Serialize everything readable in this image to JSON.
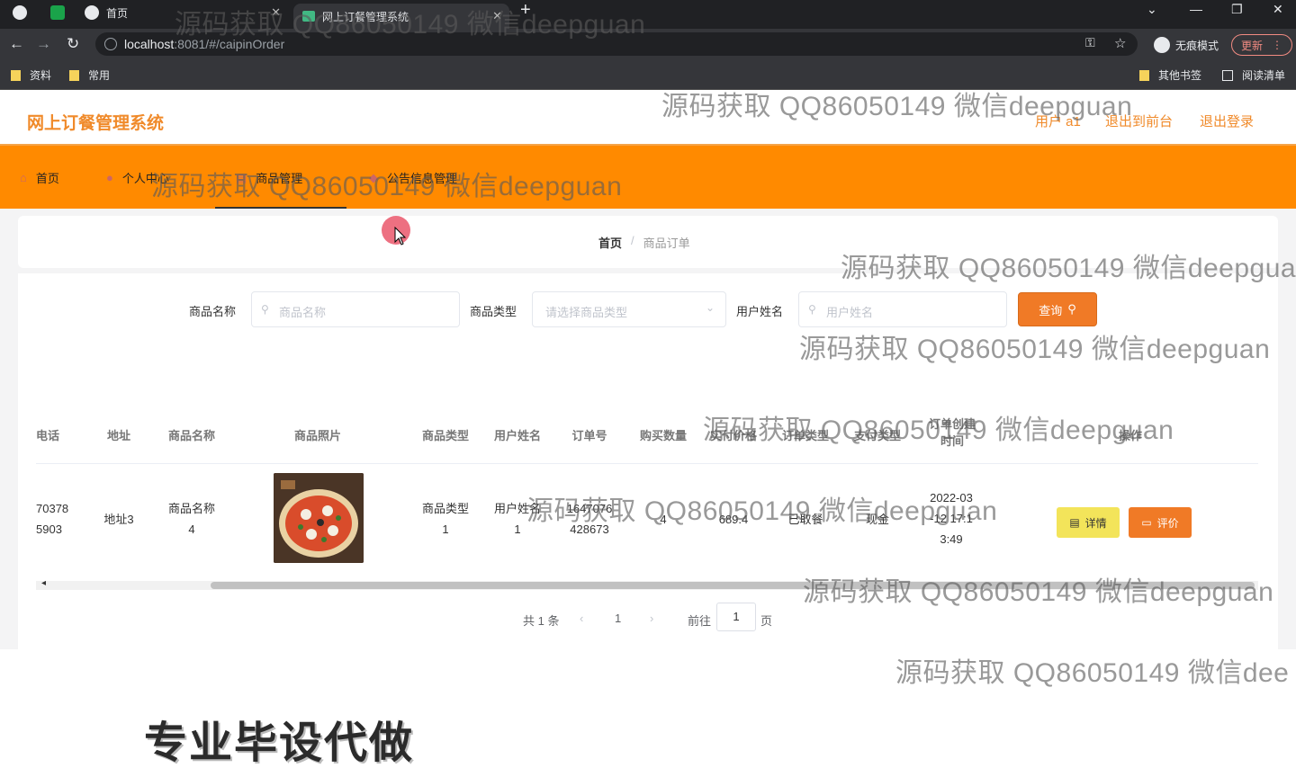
{
  "browser": {
    "tabs": [
      {
        "label": "首页"
      },
      {
        "label": "网上订餐管理系统"
      }
    ],
    "url_host": "localhost",
    "url_rest": ":8081/#/caipinOrder",
    "incognito_label": "无痕模式",
    "update_label": "更新",
    "bookmarks": [
      "资料",
      "常用"
    ],
    "bookmarks_right": [
      "其他书签",
      "阅读清单"
    ]
  },
  "app": {
    "title": "网上订餐管理系统",
    "header_links": [
      "用户 a1",
      "退出到前台",
      "退出登录"
    ],
    "nav": [
      {
        "label": "首页"
      },
      {
        "label": "个人中心"
      },
      {
        "label": "商品管理"
      },
      {
        "label": "公告信息管理"
      }
    ],
    "breadcrumb": {
      "home": "首页",
      "sep": "/",
      "current": "商品订单"
    }
  },
  "filters": {
    "name_label": "商品名称",
    "name_placeholder": "商品名称",
    "type_label": "商品类型",
    "type_placeholder": "请选择商品类型",
    "user_label": "用户姓名",
    "user_placeholder": "用户姓名",
    "query_label": "查询"
  },
  "table": {
    "headers": [
      "电话",
      "地址",
      "商品名称",
      "商品照片",
      "商品类型",
      "用户姓名",
      "订单号",
      "购买数量",
      "实付价格",
      "订单类型",
      "支付类型",
      "订单创建时间",
      "操作"
    ],
    "row": {
      "phone": [
        "70378",
        "5903"
      ],
      "address": "地址3",
      "name": [
        "商品名称",
        "4"
      ],
      "type": [
        "商品类型",
        "1"
      ],
      "user": [
        "用户姓名",
        "1"
      ],
      "order_no": [
        "1647076",
        "428673"
      ],
      "qty": "4",
      "price": "689.4",
      "order_type": "已取餐",
      "pay_type": "现金",
      "time": [
        "2022-03",
        "-12 17:1",
        "3:49"
      ],
      "detail_label": "详情",
      "review_label": "评价"
    }
  },
  "pagination": {
    "total": "共 1 条",
    "current": "1",
    "goto": "前往",
    "goto_value": "1",
    "page": "页"
  },
  "watermark_text": "源码获取 QQ86050149 微信deepguan",
  "watermark_trunc_1": "源码获取 QQ86050149 微信deepgua",
  "watermark_trunc_2": "源码获取 QQ86050149 微信dee",
  "ad_text": "专业毕设代做"
}
